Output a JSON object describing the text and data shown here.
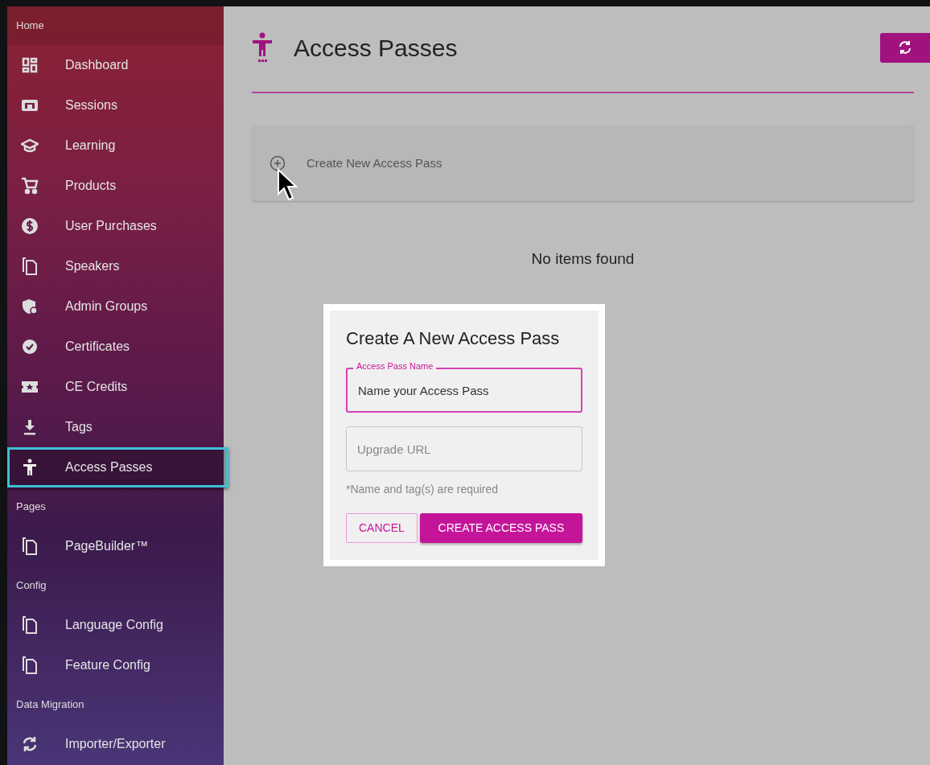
{
  "sidebar": {
    "items": [
      {
        "kind": "header",
        "label": "Home"
      },
      {
        "kind": "item",
        "label": "Dashboard",
        "selected": false
      },
      {
        "kind": "item",
        "label": "Sessions",
        "selected": false
      },
      {
        "kind": "item",
        "label": "Learning",
        "selected": false
      },
      {
        "kind": "item",
        "label": "Products",
        "selected": false
      },
      {
        "kind": "item",
        "label": "User Purchases",
        "selected": false
      },
      {
        "kind": "item",
        "label": "Speakers",
        "selected": false
      },
      {
        "kind": "item",
        "label": "Admin Groups",
        "selected": false
      },
      {
        "kind": "item",
        "label": "Certificates",
        "selected": false
      },
      {
        "kind": "item",
        "label": "CE Credits",
        "selected": false
      },
      {
        "kind": "item",
        "label": "Tags",
        "selected": false
      },
      {
        "kind": "item",
        "label": "Access Passes",
        "selected": true
      },
      {
        "kind": "header",
        "label": "Pages"
      },
      {
        "kind": "item",
        "label": "PageBuilder™",
        "selected": false
      },
      {
        "kind": "header",
        "label": "Config"
      },
      {
        "kind": "item",
        "label": "Language Config",
        "selected": false
      },
      {
        "kind": "item",
        "label": "Feature Config",
        "selected": false
      },
      {
        "kind": "header",
        "label": "Data Migration"
      },
      {
        "kind": "item",
        "label": "Importer/Exporter",
        "selected": false
      }
    ]
  },
  "page": {
    "title": "Access Passes",
    "create_label": "Create New Access Pass",
    "empty_text": "No items found"
  },
  "dialog": {
    "title": "Create A New Access Pass",
    "fields": [
      {
        "label": "Access Pass Name",
        "value": "Name your Access Pass",
        "focused": true
      },
      {
        "placeholder": "Upgrade URL",
        "focused": false
      }
    ],
    "hint": "*Name and tag(s) are required",
    "buttons": [
      {
        "kind": "outlined",
        "label": "CANCEL"
      },
      {
        "kind": "filled",
        "label": "CREATE ACCESS PASS"
      }
    ]
  }
}
